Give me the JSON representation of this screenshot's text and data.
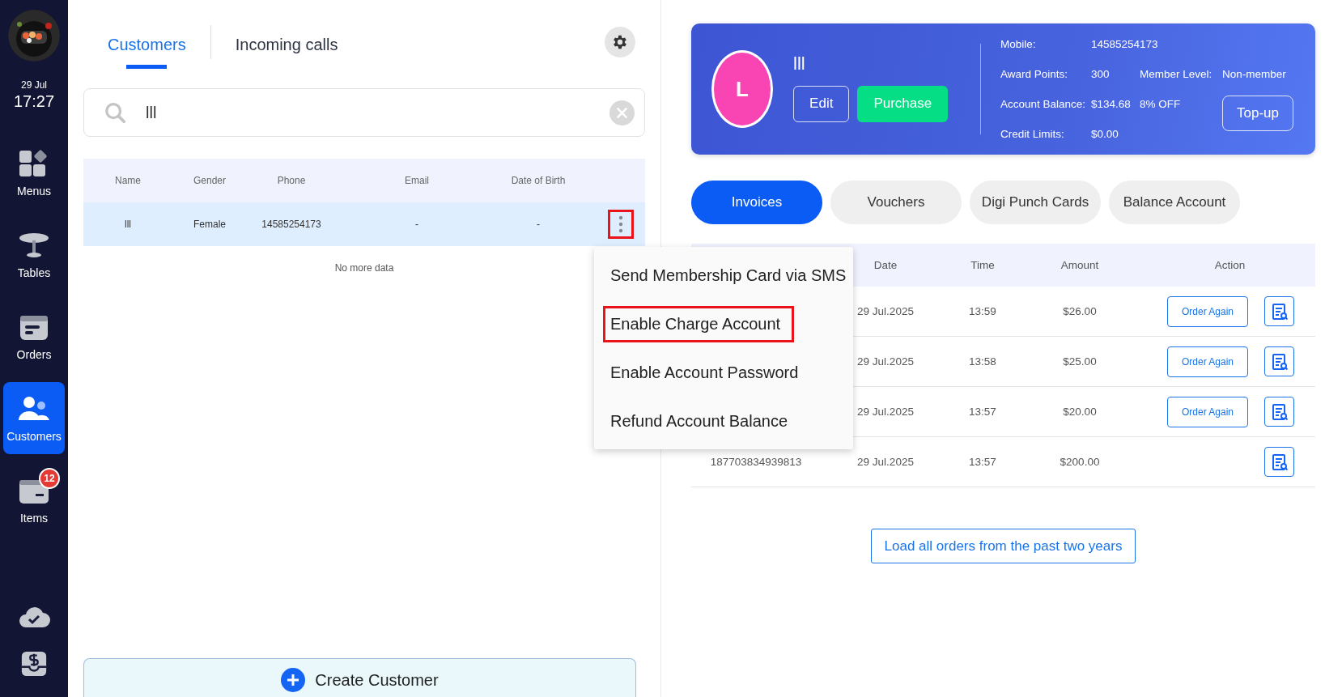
{
  "sidebar": {
    "date": "29 Jul",
    "time": "17:27",
    "items": [
      {
        "label": "Menus",
        "selected": false
      },
      {
        "label": "Tables",
        "selected": false
      },
      {
        "label": "Orders",
        "selected": false
      },
      {
        "label": "Customers",
        "selected": true
      },
      {
        "label": "Items",
        "selected": false,
        "badge": "12"
      }
    ]
  },
  "tabs": [
    {
      "label": "Customers",
      "selected": true
    },
    {
      "label": "Incoming calls",
      "selected": false
    }
  ],
  "search": {
    "value": "lll"
  },
  "customers_table": {
    "columns": [
      "Name",
      "Gender",
      "Phone",
      "Email",
      "Date of Birth"
    ],
    "rows": [
      {
        "cells": [
          "lll",
          "Female",
          "14585254173",
          "-",
          "-"
        ],
        "selected": true,
        "menu_highlighted": true
      }
    ],
    "footer": "No more data"
  },
  "row_menu": {
    "items": [
      {
        "label": "Send Membership Card via SMS",
        "highlighted": false
      },
      {
        "label": "Enable Charge Account",
        "highlighted": true
      },
      {
        "label": "Enable Account Password",
        "highlighted": false
      },
      {
        "label": "Refund Account Balance",
        "highlighted": false
      }
    ]
  },
  "create_button": "Create Customer",
  "profile": {
    "avatar_letter": "L",
    "name": "lll",
    "buttons": [
      "Edit",
      "Purchase"
    ],
    "info_rows": [
      [
        "Mobile:",
        "14585254173"
      ],
      [
        "Award Points:",
        "300",
        "Member Level:",
        "Non-member"
      ],
      [
        "Account Balance:",
        "$134.68",
        "8% OFF"
      ],
      [
        "Credit Limits:",
        "$0.00"
      ]
    ],
    "topup": "Top-up"
  },
  "record_tabs": [
    {
      "label": "Invoices",
      "selected": true
    },
    {
      "label": "Vouchers",
      "selected": false
    },
    {
      "label": "Digi Punch Cards",
      "selected": false
    },
    {
      "label": "Balance Account",
      "selected": false
    }
  ],
  "invoices": {
    "columns": [
      "Date",
      "Time",
      "Amount",
      "Action"
    ],
    "rows": [
      {
        "date": "29 Jul.2025",
        "time": "13:59",
        "amount": "$26.00",
        "order_again": "Order Again"
      },
      {
        "date": "29 Jul.2025",
        "time": "13:58",
        "amount": "$25.00",
        "order_again": "Order Again"
      },
      {
        "date": "29 Jul.2025",
        "time": "13:57",
        "amount": "$20.00",
        "order_again": "Order Again"
      },
      {
        "id": "187703834939813",
        "date": "29 Jul.2025",
        "time": "13:57",
        "amount": "$200.00"
      }
    ]
  },
  "load_more": "Load all orders from the past two years"
}
